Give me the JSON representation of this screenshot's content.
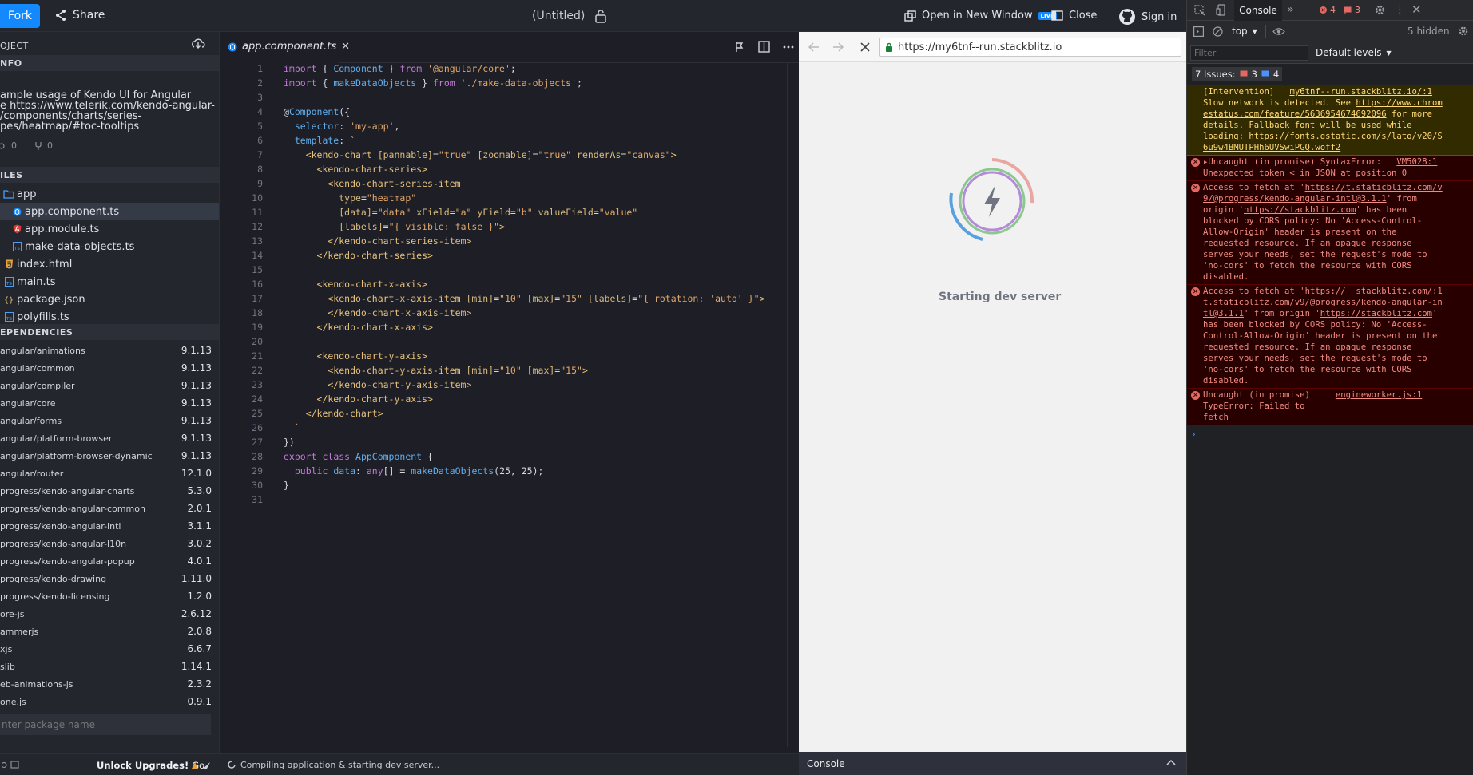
{
  "topbar": {
    "fork_label": "Fork",
    "share_label": "Share",
    "project_title": "(Untitled)",
    "open_new_window_label": "Open in New Window",
    "live_badge": "LIVE",
    "close_label": "Close",
    "signin_label": "Sign in"
  },
  "sidebar": {
    "project_header": "OJECT",
    "info_header": "NFO",
    "info_lines": [
      "ample usage of Kendo UI for Angular",
      "e https://www.telerik.com/kendo-angular-",
      "/components/charts/series-",
      "pes/heatmap/#toc-tooltips"
    ],
    "views_count": "0",
    "forks_count": "0",
    "files_header": "ILES",
    "files": [
      {
        "name": "app",
        "icon": "folder-icon",
        "indent": 0
      },
      {
        "name": "app.component.ts",
        "icon": "angular-component-icon",
        "indent": 1,
        "active": true
      },
      {
        "name": "app.module.ts",
        "icon": "angular-icon",
        "indent": 1
      },
      {
        "name": "make-data-objects.ts",
        "icon": "typescript-icon",
        "indent": 1
      },
      {
        "name": "index.html",
        "icon": "html-icon",
        "indent": 0
      },
      {
        "name": "main.ts",
        "icon": "typescript-icon",
        "indent": 0
      },
      {
        "name": "package.json",
        "icon": "json-icon",
        "indent": 0
      },
      {
        "name": "polyfills.ts",
        "icon": "typescript-icon",
        "indent": 0
      }
    ],
    "deps_header": "EPENDENCIES",
    "dependencies": [
      {
        "name": "angular/animations",
        "version": "9.1.13"
      },
      {
        "name": "angular/common",
        "version": "9.1.13"
      },
      {
        "name": "angular/compiler",
        "version": "9.1.13"
      },
      {
        "name": "angular/core",
        "version": "9.1.13"
      },
      {
        "name": "angular/forms",
        "version": "9.1.13"
      },
      {
        "name": "angular/platform-browser",
        "version": "9.1.13"
      },
      {
        "name": "angular/platform-browser-dynamic",
        "version": "9.1.13"
      },
      {
        "name": "angular/router",
        "version": "12.1.0"
      },
      {
        "name": "progress/kendo-angular-charts",
        "version": "5.3.0"
      },
      {
        "name": "progress/kendo-angular-common",
        "version": "2.0.1"
      },
      {
        "name": "progress/kendo-angular-intl",
        "version": "3.1.1"
      },
      {
        "name": "progress/kendo-angular-l10n",
        "version": "3.0.2"
      },
      {
        "name": "progress/kendo-angular-popup",
        "version": "4.0.1"
      },
      {
        "name": "progress/kendo-drawing",
        "version": "1.11.0"
      },
      {
        "name": "progress/kendo-licensing",
        "version": "1.2.0"
      },
      {
        "name": "ore-js",
        "version": "2.6.12"
      },
      {
        "name": "ammerjs",
        "version": "2.0.8"
      },
      {
        "name": "xjs",
        "version": "6.6.7"
      },
      {
        "name": "slib",
        "version": "1.14.1"
      },
      {
        "name": "eb-animations-js",
        "version": "2.3.2"
      },
      {
        "name": "one.js",
        "version": "0.9.1"
      }
    ],
    "package_placeholder": "nter package name",
    "unlock_label": "Unlock Upgrades!",
    "go_label": "Go"
  },
  "editor": {
    "tab_label": "app.component.ts",
    "status_text": "Compiling application & starting dev server...",
    "lines": [
      [
        [
          "kw",
          "import"
        ],
        [
          "plain",
          " { "
        ],
        [
          "ident",
          "Component"
        ],
        [
          "plain",
          " } "
        ],
        [
          "kw",
          "from"
        ],
        [
          "str",
          " '@angular/core'"
        ],
        [
          "plain",
          ";"
        ]
      ],
      [
        [
          "kw",
          "import"
        ],
        [
          "plain",
          " { "
        ],
        [
          "ident",
          "makeDataObjects"
        ],
        [
          "plain",
          " } "
        ],
        [
          "kw",
          "from"
        ],
        [
          "str",
          " './make-data-objects'"
        ],
        [
          "plain",
          ";"
        ]
      ],
      [],
      [
        [
          "plain",
          "@"
        ],
        [
          "ident",
          "Component"
        ],
        [
          "plain",
          "({"
        ]
      ],
      [
        [
          "ident",
          "  selector"
        ],
        [
          "plain",
          ": "
        ],
        [
          "str",
          "'my-app'"
        ],
        [
          "plain",
          ","
        ]
      ],
      [
        [
          "ident",
          "  template"
        ],
        [
          "plain",
          ": "
        ],
        [
          "str",
          "`"
        ]
      ],
      [
        [
          "tag",
          "    <kendo-chart"
        ],
        [
          "attr",
          " [pannable]"
        ],
        [
          "plain",
          "="
        ],
        [
          "str",
          "\"true\""
        ],
        [
          "attr",
          " [zoomable]"
        ],
        [
          "plain",
          "="
        ],
        [
          "str",
          "\"true\""
        ],
        [
          "attr",
          " renderAs"
        ],
        [
          "plain",
          "="
        ],
        [
          "str",
          "\"canvas\""
        ],
        [
          "tag",
          ">"
        ]
      ],
      [
        [
          "tag",
          "      <kendo-chart-series>"
        ]
      ],
      [
        [
          "tag",
          "        <kendo-chart-series-item"
        ]
      ],
      [
        [
          "attr",
          "          type"
        ],
        [
          "plain",
          "="
        ],
        [
          "str",
          "\"heatmap\""
        ]
      ],
      [
        [
          "attr",
          "          [data]"
        ],
        [
          "plain",
          "="
        ],
        [
          "str",
          "\"data\""
        ],
        [
          "attr",
          " xField"
        ],
        [
          "plain",
          "="
        ],
        [
          "str",
          "\"a\""
        ],
        [
          "attr",
          " yField"
        ],
        [
          "plain",
          "="
        ],
        [
          "str",
          "\"b\""
        ],
        [
          "attr",
          " valueField"
        ],
        [
          "plain",
          "="
        ],
        [
          "str",
          "\"value\""
        ]
      ],
      [
        [
          "attr",
          "          [labels]"
        ],
        [
          "plain",
          "="
        ],
        [
          "str",
          "\"{ visible: false }\""
        ],
        [
          "tag",
          ">"
        ]
      ],
      [
        [
          "tag",
          "        </kendo-chart-series-item>"
        ]
      ],
      [
        [
          "tag",
          "      </kendo-chart-series>"
        ]
      ],
      [],
      [
        [
          "tag",
          "      <kendo-chart-x-axis>"
        ]
      ],
      [
        [
          "tag",
          "        <kendo-chart-x-axis-item"
        ],
        [
          "attr",
          " [min]"
        ],
        [
          "plain",
          "="
        ],
        [
          "str",
          "\"10\""
        ],
        [
          "attr",
          " [max]"
        ],
        [
          "plain",
          "="
        ],
        [
          "str",
          "\"15\""
        ],
        [
          "attr",
          " [labels]"
        ],
        [
          "plain",
          "="
        ],
        [
          "str",
          "\"{ rotation: 'auto' }\""
        ],
        [
          "tag",
          ">"
        ]
      ],
      [
        [
          "tag",
          "        </kendo-chart-x-axis-item>"
        ]
      ],
      [
        [
          "tag",
          "      </kendo-chart-x-axis>"
        ]
      ],
      [],
      [
        [
          "tag",
          "      <kendo-chart-y-axis>"
        ]
      ],
      [
        [
          "tag",
          "        <kendo-chart-y-axis-item"
        ],
        [
          "attr",
          " [min]"
        ],
        [
          "plain",
          "="
        ],
        [
          "str",
          "\"10\""
        ],
        [
          "attr",
          " [max]"
        ],
        [
          "plain",
          "="
        ],
        [
          "str",
          "\"15\""
        ],
        [
          "tag",
          ">"
        ]
      ],
      [
        [
          "tag",
          "        </kendo-chart-y-axis-item>"
        ]
      ],
      [
        [
          "tag",
          "      </kendo-chart-y-axis>"
        ]
      ],
      [
        [
          "tag",
          "    </kendo-chart>"
        ]
      ],
      [
        [
          "str",
          "  `"
        ]
      ],
      [
        [
          "plain",
          "})"
        ]
      ],
      [
        [
          "kw",
          "export"
        ],
        [
          "kw",
          " class"
        ],
        [
          "ident",
          " AppComponent"
        ],
        [
          "plain",
          " {"
        ]
      ],
      [
        [
          "kw",
          "  public"
        ],
        [
          "ident",
          " data"
        ],
        [
          "plain",
          ": "
        ],
        [
          "kw",
          "any"
        ],
        [
          "plain",
          "[] = "
        ],
        [
          "ident",
          "makeDataObjects"
        ],
        [
          "plain",
          "(25, 25);"
        ]
      ],
      [
        [
          "plain",
          "}"
        ]
      ],
      []
    ]
  },
  "preview": {
    "url": "https://my6tnf--run.stackblitz.io",
    "loading_text": "Starting dev server",
    "console_label": "Console"
  },
  "devtools": {
    "console_tab": "Console",
    "error_count": "4",
    "issue_count_badge": "3",
    "context_label": "top",
    "hidden_label": "5 hidden",
    "filter_placeholder": "Filter",
    "levels_label": "Default levels",
    "issues_label": "7 Issues:",
    "issues_errors": "3",
    "issues_info": "4",
    "messages": [
      {
        "type": "warn",
        "text_lines": [
          [
            [
              "t",
              "[Intervention]   "
            ],
            [
              "l",
              "my6tnf--run.stackblitz.io/:1"
            ]
          ],
          [
            [
              "t",
              "Slow network is detected. See "
            ],
            [
              "l",
              "https://www.chrom"
            ]
          ],
          [
            [
              "l",
              "estatus.com/feature/5636954674692096"
            ],
            [
              "t",
              " for more"
            ]
          ],
          [
            [
              "t",
              "details. Fallback font will be used while"
            ]
          ],
          [
            [
              "t",
              "loading: "
            ],
            [
              "l",
              "https://fonts.gstatic.com/s/lato/v20/S"
            ]
          ],
          [
            [
              "l",
              "6u9w4BMUTPHh6UVSwiPGQ.woff2"
            ]
          ]
        ]
      },
      {
        "type": "err",
        "text_lines": [
          [
            [
              "t",
              "▸Uncaught (in promise) SyntaxError:   "
            ],
            [
              "l",
              "VM5028:1"
            ]
          ],
          [
            [
              "t",
              "Unexpected token < in JSON at position 0"
            ]
          ]
        ]
      },
      {
        "type": "err",
        "text_lines": [
          [
            [
              "t",
              "Access to fetch at '"
            ],
            [
              "l",
              "https://t.staticblitz.com/v"
            ]
          ],
          [
            [
              "l",
              "9/@progress/kendo-angular-intl@3.1.1"
            ],
            [
              "t",
              "' from"
            ]
          ],
          [
            [
              "t",
              "origin '"
            ],
            [
              "l",
              "https://stackblitz.com"
            ],
            [
              "t",
              "' has been"
            ]
          ],
          [
            [
              "t",
              "blocked by CORS policy: No 'Access-Control-"
            ]
          ],
          [
            [
              "t",
              "Allow-Origin' header is present on the"
            ]
          ],
          [
            [
              "t",
              "requested resource. If an opaque response"
            ]
          ],
          [
            [
              "t",
              "serves your needs, set the request's mode to"
            ]
          ],
          [
            [
              "t",
              "'no-cors' to fetch the resource with CORS"
            ]
          ],
          [
            [
              "t",
              "disabled."
            ]
          ]
        ]
      },
      {
        "type": "err",
        "text_lines": [
          [
            [
              "t",
              "Access to fetch at '"
            ],
            [
              "l",
              "https://  stackblitz.com/:1"
            ]
          ],
          [
            [
              "l",
              "t.staticblitz.com/v9/@progress/kendo-angular-in"
            ]
          ],
          [
            [
              "l",
              "tl@3.1.1"
            ],
            [
              "t",
              "' from origin '"
            ],
            [
              "l",
              "https://stackblitz.com"
            ],
            [
              "t",
              "'"
            ]
          ],
          [
            [
              "t",
              "has been blocked by CORS policy: No 'Access-"
            ]
          ],
          [
            [
              "t",
              "Control-Allow-Origin' header is present on the"
            ]
          ],
          [
            [
              "t",
              "requested resource. If an opaque response"
            ]
          ],
          [
            [
              "t",
              "serves your needs, set the request's mode to"
            ]
          ],
          [
            [
              "t",
              "'no-cors' to fetch the resource with CORS"
            ]
          ],
          [
            [
              "t",
              "disabled."
            ]
          ]
        ]
      },
      {
        "type": "err",
        "text_lines": [
          [
            [
              "t",
              "Uncaught (in promise)     "
            ],
            [
              "l",
              "engineworker.js:1"
            ]
          ],
          [
            [
              "t",
              "TypeError: Failed to"
            ]
          ],
          [
            [
              "t",
              "fetch"
            ]
          ]
        ]
      }
    ]
  },
  "colors": {
    "accent": "#1389fd",
    "editor_bg": "#1e1f26",
    "sidebar_bg": "#24262e",
    "active_file_bg": "#353a47"
  }
}
